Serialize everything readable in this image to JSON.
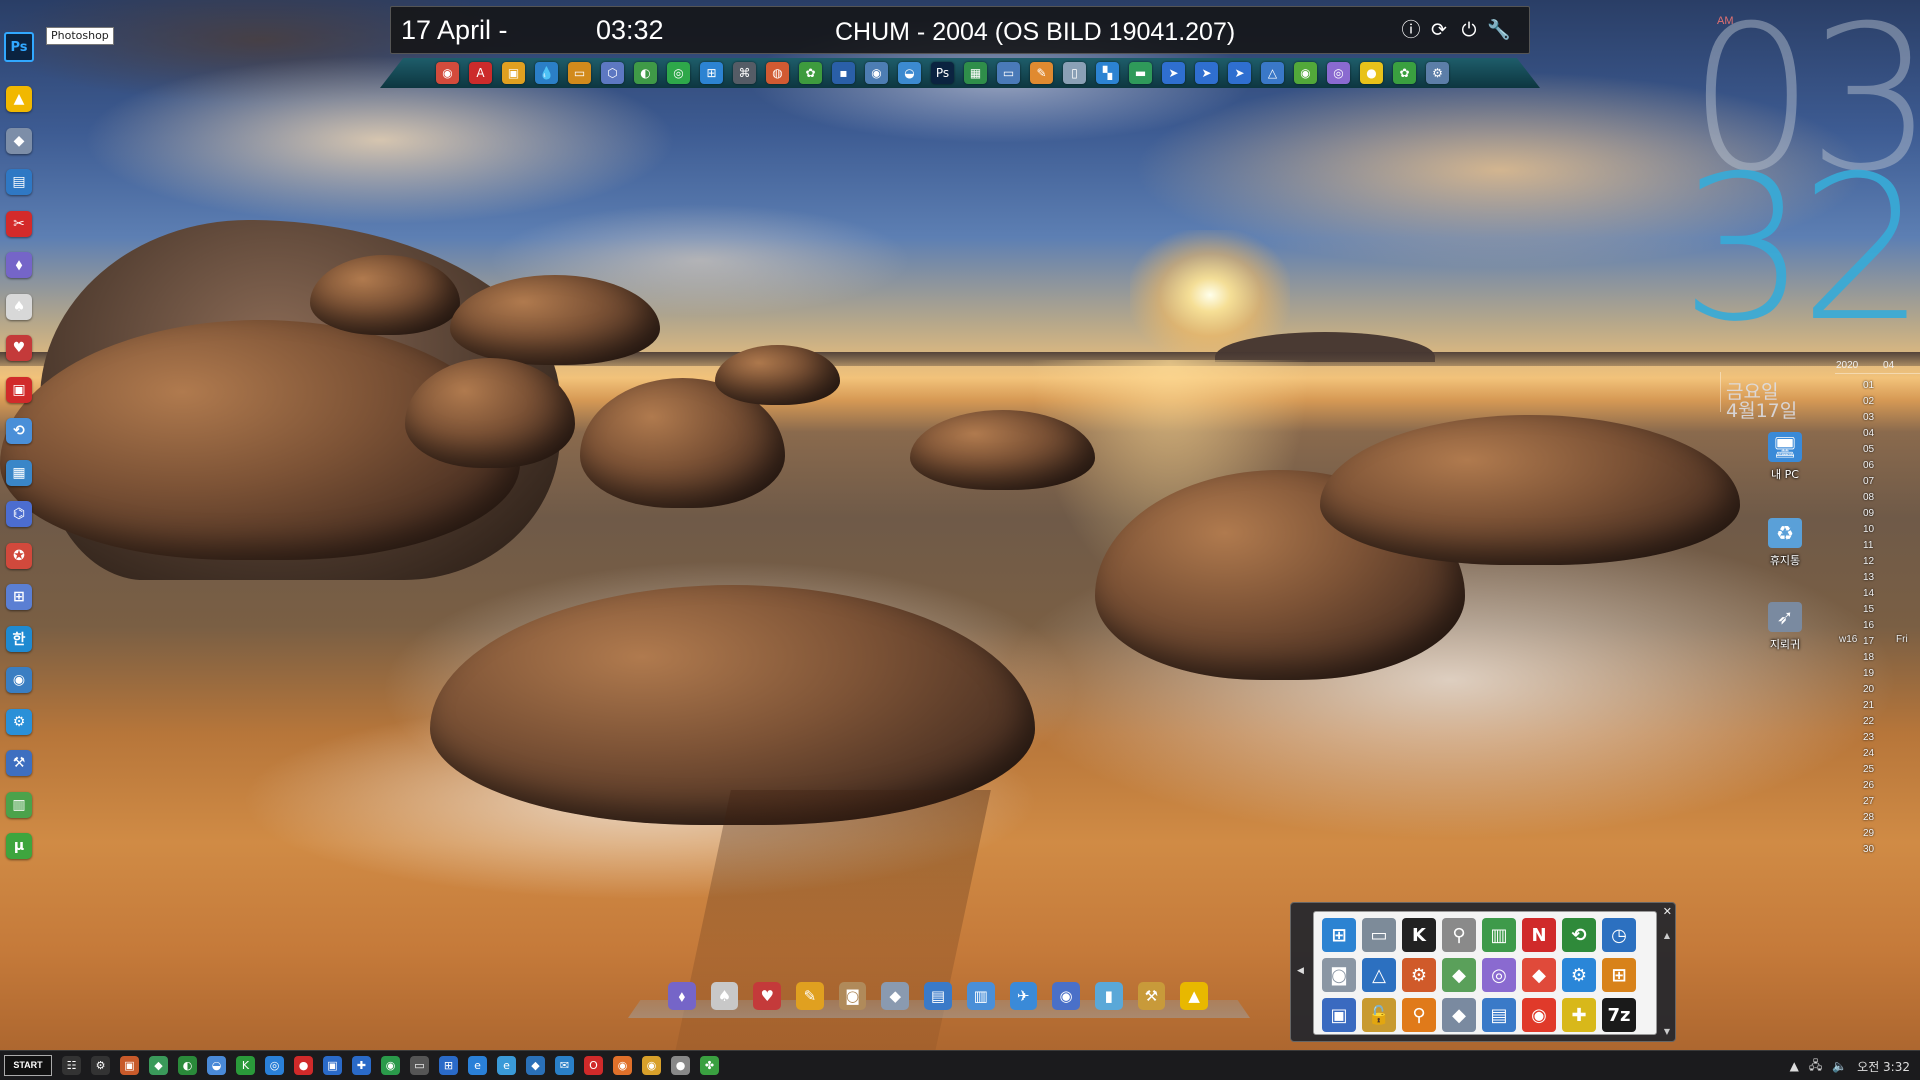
{
  "screen": {
    "width": 1920,
    "height": 1080
  },
  "left_dock": {
    "tooltip": "Photoshop",
    "ps_icon_label": "Ps",
    "items": [
      {
        "name": "aimp-icon",
        "glyph": "▲",
        "color": "#f1b800"
      },
      {
        "name": "eraser-icon",
        "glyph": "◆",
        "color": "#7d8ea8"
      },
      {
        "name": "remote-desktop-icon",
        "glyph": "▤",
        "color": "#2f78c4"
      },
      {
        "name": "scissors-icon",
        "glyph": "✂",
        "color": "#d42a2a"
      },
      {
        "name": "program-installer-icon",
        "glyph": "⬧",
        "color": "#7565c8"
      },
      {
        "name": "card-solitaire-icon",
        "glyph": "♠",
        "color": "#d8d8d8"
      },
      {
        "name": "freecell-icon",
        "glyph": "♥",
        "color": "#c43a3a"
      },
      {
        "name": "screen-recorder-icon",
        "glyph": "▣",
        "color": "#d12a2a"
      },
      {
        "name": "system-restore-icon",
        "glyph": "⟲",
        "color": "#4a8fd8"
      },
      {
        "name": "file-manager-icon",
        "glyph": "▦",
        "color": "#3a86c8"
      },
      {
        "name": "network-icon",
        "glyph": "⌬",
        "color": "#4c6dd0"
      },
      {
        "name": "cleaner-icon",
        "glyph": "✪",
        "color": "#d1493c"
      },
      {
        "name": "windows-tools-icon",
        "glyph": "⊞",
        "color": "#5b7fd3"
      },
      {
        "name": "hangul-icon",
        "glyph": "한",
        "color": "#1f8ad1"
      },
      {
        "name": "backup-icon",
        "glyph": "◉",
        "color": "#3a7ec2"
      },
      {
        "name": "settings-icon",
        "glyph": "⚙",
        "color": "#2a90d8"
      },
      {
        "name": "hammer-tool-icon",
        "glyph": "⚒",
        "color": "#3e6fc0"
      },
      {
        "name": "chart-report-icon",
        "glyph": "▥",
        "color": "#4ba24b"
      },
      {
        "name": "utorrent-icon",
        "glyph": "µ",
        "color": "#3ea53e"
      }
    ]
  },
  "topbar": {
    "date": "17 April -",
    "time": "03:32",
    "title": "CHUM - 2004 (OS BILD 19041.207)",
    "controls": [
      {
        "name": "info-icon",
        "glyph": "ⓘ"
      },
      {
        "name": "restart-icon",
        "glyph": "⟳"
      },
      {
        "name": "power-icon",
        "glyph": "⏻"
      },
      {
        "name": "wrench-icon",
        "glyph": "🔧"
      }
    ]
  },
  "launcher": {
    "items": [
      {
        "name": "chrome-icon",
        "glyph": "◉",
        "color": "#d34b3c"
      },
      {
        "name": "acrobat-icon",
        "glyph": "A",
        "color": "#cc2b2b"
      },
      {
        "name": "photo-viewer-icon",
        "glyph": "▣",
        "color": "#e0a020"
      },
      {
        "name": "water-drop-icon",
        "glyph": "💧",
        "color": "#2b7fc7"
      },
      {
        "name": "window-switch-icon",
        "glyph": "▭",
        "color": "#d28a1c"
      },
      {
        "name": "virtualbox-icon",
        "glyph": "⬡",
        "color": "#5d78c2"
      },
      {
        "name": "disk-tool-icon",
        "glyph": "◐",
        "color": "#3f9a47"
      },
      {
        "name": "spotify-icon",
        "glyph": "◎",
        "color": "#2ea84a"
      },
      {
        "name": "windows-icon",
        "glyph": "⊞",
        "color": "#2c83d2"
      },
      {
        "name": "gamepad-icon",
        "glyph": "⌘",
        "color": "#555c66"
      },
      {
        "name": "browser-icon",
        "glyph": "◍",
        "color": "#d15a32"
      },
      {
        "name": "frog-icon",
        "glyph": "✿",
        "color": "#3e9b3e"
      },
      {
        "name": "floppy-icon",
        "glyph": "▪",
        "color": "#2a5fa8"
      },
      {
        "name": "webcam-icon",
        "glyph": "◉",
        "color": "#4d7db3"
      },
      {
        "name": "media-icon",
        "glyph": "◒",
        "color": "#3c8ad0"
      },
      {
        "name": "photoshop-mini-icon",
        "glyph": "Ps",
        "color": "#0b2340"
      },
      {
        "name": "spreadsheet-icon",
        "glyph": "▦",
        "color": "#2f8e4a"
      },
      {
        "name": "monitor-icon",
        "glyph": "▭",
        "color": "#4a7ab8"
      },
      {
        "name": "paint-icon",
        "glyph": "✎",
        "color": "#e08a30"
      },
      {
        "name": "notepad-icon",
        "glyph": "▯",
        "color": "#8aa0b6"
      },
      {
        "name": "start-tiles-icon",
        "glyph": "▚",
        "color": "#2c83d2"
      },
      {
        "name": "display-icon",
        "glyph": "▬",
        "color": "#2f9a5a"
      },
      {
        "name": "arrow-blue-1-icon",
        "glyph": "➤",
        "color": "#2f6fd0"
      },
      {
        "name": "arrow-blue-2-icon",
        "glyph": "➤",
        "color": "#2f6fd0"
      },
      {
        "name": "arrow-blue-3-icon",
        "glyph": "➤",
        "color": "#2f6fd0"
      },
      {
        "name": "drive-icon",
        "glyph": "△",
        "color": "#3a78c8"
      },
      {
        "name": "green-globe-icon",
        "glyph": "◉",
        "color": "#52a83a"
      },
      {
        "name": "disc-icon",
        "glyph": "◎",
        "color": "#8a6ad0"
      },
      {
        "name": "yellow-circle-icon",
        "glyph": "●",
        "color": "#e8c21a"
      },
      {
        "name": "green-frog-icon",
        "glyph": "✿",
        "color": "#3aa040"
      },
      {
        "name": "tools-icon",
        "glyph": "⚙",
        "color": "#5c7ea8"
      }
    ]
  },
  "big_clock": {
    "hour": "03",
    "minute": "32",
    "ampm": "AM"
  },
  "korean_date": {
    "weekday": "금요일",
    "date": "4월17일"
  },
  "calendar": {
    "year": "2020",
    "month": "04",
    "days": [
      "01",
      "02",
      "03",
      "04",
      "05",
      "06",
      "07",
      "08",
      "09",
      "10",
      "11",
      "12",
      "13",
      "14",
      "15",
      "16",
      "17",
      "18",
      "19",
      "20",
      "21",
      "22",
      "23",
      "24",
      "25",
      "26",
      "27",
      "28",
      "29",
      "30"
    ],
    "week_label": "w16",
    "weekday_label": "Fri"
  },
  "desktop_icons": [
    {
      "name": "my-pc-icon",
      "label": "내 PC",
      "glyph": "🖥",
      "color": "#3a8ad8"
    },
    {
      "name": "recycle-bin-icon",
      "label": "휴지통",
      "glyph": "♻",
      "color": "#5aa0d8"
    },
    {
      "name": "mouse-pointer-icon",
      "label": "지뢰귀",
      "glyph": "➶",
      "color": "#7a8aa0"
    }
  ],
  "bottom_dock": {
    "items": [
      {
        "name": "installer-icon",
        "glyph": "⬧",
        "color": "#7565c8"
      },
      {
        "name": "spider-solitaire-icon",
        "glyph": "♠",
        "color": "#c8c8c8"
      },
      {
        "name": "freecell-dock-icon",
        "glyph": "♥",
        "color": "#c43a3a"
      },
      {
        "name": "paint-palette-icon",
        "glyph": "✎",
        "color": "#e0a020"
      },
      {
        "name": "camera-icon",
        "glyph": "◙",
        "color": "#b08a5a"
      },
      {
        "name": "eraser-dock-icon",
        "glyph": "◆",
        "color": "#8a9ab0"
      },
      {
        "name": "laptop-icon",
        "glyph": "▤",
        "color": "#3a7ac8"
      },
      {
        "name": "documents-icon",
        "glyph": "▥",
        "color": "#4a8fd8"
      },
      {
        "name": "airplane-icon",
        "glyph": "✈",
        "color": "#3a8ad8"
      },
      {
        "name": "globe-dock-icon",
        "glyph": "◉",
        "color": "#4a70c8"
      },
      {
        "name": "cylinder-icon",
        "glyph": "▮",
        "color": "#5aa8d8"
      },
      {
        "name": "pickaxe-icon",
        "glyph": "⚒",
        "color": "#c89a3a"
      },
      {
        "name": "aimp-dock-icon",
        "glyph": "▲",
        "color": "#e8b800"
      }
    ]
  },
  "quick_panel": {
    "items": [
      {
        "name": "windows-logo-icon",
        "glyph": "⊞",
        "color": "#2c83d2"
      },
      {
        "name": "hard-drive-icon",
        "glyph": "▭",
        "color": "#7d8b99"
      },
      {
        "name": "k-app-icon",
        "glyph": "K",
        "color": "#222222"
      },
      {
        "name": "usb-icon",
        "glyph": "⚲",
        "color": "#8a8a8a"
      },
      {
        "name": "chart-icon",
        "glyph": "▥",
        "color": "#3e9a4a"
      },
      {
        "name": "nt-pin-icon",
        "glyph": "N",
        "color": "#d02a2a"
      },
      {
        "name": "rewind-drive-icon",
        "glyph": "⟲",
        "color": "#2f8a3a"
      },
      {
        "name": "time-machine-icon",
        "glyph": "◷",
        "color": "#2c70c0"
      },
      {
        "name": "device-icon",
        "glyph": "◙",
        "color": "#8a96a4"
      },
      {
        "name": "triangle-drive-icon",
        "glyph": "△",
        "color": "#2c70c0"
      },
      {
        "name": "gear-disk-icon",
        "glyph": "⚙",
        "color": "#d05a2a"
      },
      {
        "name": "cubes-icon",
        "glyph": "◆",
        "color": "#5aa05a"
      },
      {
        "name": "dvd-icon",
        "glyph": "◎",
        "color": "#8a6ad0"
      },
      {
        "name": "anydesk-icon",
        "glyph": "◆",
        "color": "#e04a3a"
      },
      {
        "name": "cog-blue-icon",
        "glyph": "⚙",
        "color": "#2a86d8"
      },
      {
        "name": "windows-classic-icon",
        "glyph": "⊞",
        "color": "#d8821a"
      },
      {
        "name": "computer-screen-icon",
        "glyph": "▣",
        "color": "#3a6ac0"
      },
      {
        "name": "lock-icon",
        "glyph": "🔓",
        "color": "#c89a30"
      },
      {
        "name": "magnifier-icon",
        "glyph": "⚲",
        "color": "#e07a1a"
      },
      {
        "name": "eraser-panel-icon",
        "glyph": "◆",
        "color": "#7a8aa0"
      },
      {
        "name": "network-pc-icon",
        "glyph": "▤",
        "color": "#3a7ac8"
      },
      {
        "name": "camera-plus-icon",
        "glyph": "◉",
        "color": "#e03a2a"
      },
      {
        "name": "puzzle-icon",
        "glyph": "✚",
        "color": "#d8b81a"
      },
      {
        "name": "7zip-icon",
        "glyph": "7z",
        "color": "#1a1a1a"
      }
    ]
  },
  "taskbar": {
    "start_label": "START",
    "items": [
      {
        "name": "task-view-icon",
        "glyph": "☷",
        "color": "#333"
      },
      {
        "name": "settings-task-icon",
        "glyph": "⚙",
        "color": "#333"
      },
      {
        "name": "photo-task-icon",
        "glyph": "▣",
        "color": "#c85a2a"
      },
      {
        "name": "cube-task-icon",
        "glyph": "◆",
        "color": "#3a9a5a"
      },
      {
        "name": "ccleaner-task-icon",
        "glyph": "◐",
        "color": "#2a8a3a"
      },
      {
        "name": "car-task-icon",
        "glyph": "◒",
        "color": "#4a8ad8"
      },
      {
        "name": "k-task-icon",
        "glyph": "K",
        "color": "#2a9a3a"
      },
      {
        "name": "edge-task-icon",
        "glyph": "◎",
        "color": "#2a80d8"
      },
      {
        "name": "stop-task-icon",
        "glyph": "●",
        "color": "#d02a2a"
      },
      {
        "name": "box-task-icon",
        "glyph": "▣",
        "color": "#2a6ac8"
      },
      {
        "name": "plus-task-icon",
        "glyph": "✚",
        "color": "#2a6ac8"
      },
      {
        "name": "globe-task-icon",
        "glyph": "◉",
        "color": "#2a9a4a"
      },
      {
        "name": "monitor-task-icon",
        "glyph": "▭",
        "color": "#555"
      },
      {
        "name": "windows-task-icon",
        "glyph": "⊞",
        "color": "#2a6ac8"
      },
      {
        "name": "ie-task-icon",
        "glyph": "e",
        "color": "#2a80d8"
      },
      {
        "name": "ie2-task-icon",
        "glyph": "e",
        "color": "#3a9ad8"
      },
      {
        "name": "bird-task-icon",
        "glyph": "◆",
        "color": "#2a70b8"
      },
      {
        "name": "mail-task-icon",
        "glyph": "✉",
        "color": "#2a80c8"
      },
      {
        "name": "opera-task-icon",
        "glyph": "O",
        "color": "#d02a2a"
      },
      {
        "name": "firefox-task-icon",
        "glyph": "◉",
        "color": "#e0702a"
      },
      {
        "name": "chrome-task-icon",
        "glyph": "◉",
        "color": "#d8a02a"
      },
      {
        "name": "circle-task-icon",
        "glyph": "●",
        "color": "#888"
      },
      {
        "name": "clover-task-icon",
        "glyph": "✤",
        "color": "#3aa040"
      }
    ],
    "tray": {
      "chevron": "▲",
      "network": "🖧",
      "volume": "🔈",
      "clock": "오전 3:32"
    }
  }
}
